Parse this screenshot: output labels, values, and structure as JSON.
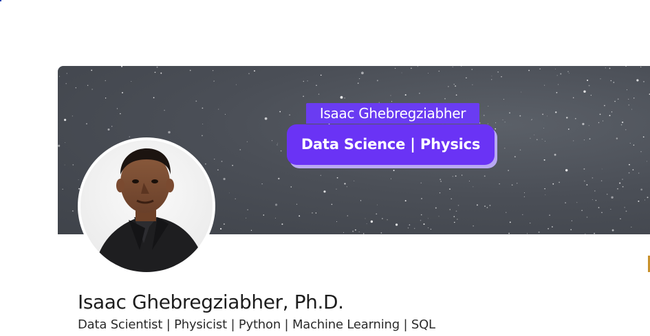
{
  "profile": {
    "name": "Isaac Ghebregziabher, Ph.D.",
    "headline": "Data Scientist | Physicist | Python | Machine Learning | SQL"
  },
  "banner": {
    "tag_name": "Isaac Ghebregziabher",
    "tagline": "Data Science | Physics",
    "background": "starry night sky",
    "colors": {
      "accent": "#6a33f5",
      "sky": "#4b4f57"
    }
  },
  "avatar": {
    "description_icon": "profile-photo"
  }
}
